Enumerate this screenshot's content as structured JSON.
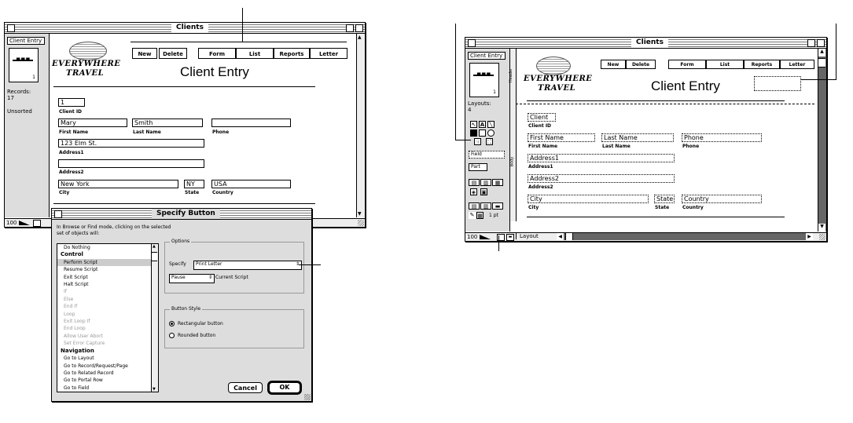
{
  "left_window": {
    "title": "Clients",
    "sidebar": {
      "layout_menu": "Client Entry",
      "book_page": "1",
      "records_label": "Records:",
      "records_count": "17",
      "unsorted": "Unsorted",
      "zoom": "100"
    },
    "logo": {
      "line1": "EVERYWHERE",
      "line2": "TRAVEL"
    },
    "buttons": [
      "New",
      "Delete",
      "Form",
      "List",
      "Reports",
      "Letter"
    ],
    "page_title": "Client Entry",
    "fields": {
      "client_id": {
        "value": "1",
        "label": "Client ID"
      },
      "first_name": {
        "value": "Mary",
        "label": "First Name"
      },
      "last_name": {
        "value": "Smith",
        "label": "Last Name"
      },
      "phone": {
        "value": "",
        "label": "Phone"
      },
      "address1": {
        "value": "123 Elm St.",
        "label": "Address1"
      },
      "address2": {
        "value": "",
        "label": "Address2"
      },
      "city": {
        "value": "New York",
        "label": "City"
      },
      "state": {
        "value": "NY",
        "label": "State"
      },
      "country": {
        "value": "USA",
        "label": "Country"
      }
    }
  },
  "dialog": {
    "title": "Specify Button",
    "instructions": "In Browse or Find mode, clicking on the selected set of objects will:",
    "script_list": [
      {
        "text": "Do Nothing",
        "kind": "item"
      },
      {
        "text": "Control",
        "kind": "header"
      },
      {
        "text": "Perform Script",
        "kind": "selected"
      },
      {
        "text": "Resume Script",
        "kind": "item"
      },
      {
        "text": "Exit Script",
        "kind": "item"
      },
      {
        "text": "Halt Script",
        "kind": "item"
      },
      {
        "text": "If",
        "kind": "disabled"
      },
      {
        "text": "Else",
        "kind": "disabled"
      },
      {
        "text": "End If",
        "kind": "disabled"
      },
      {
        "text": "Loop",
        "kind": "disabled"
      },
      {
        "text": "Exit Loop If",
        "kind": "disabled"
      },
      {
        "text": "End Loop",
        "kind": "disabled"
      },
      {
        "text": "Allow User Abort",
        "kind": "disabled"
      },
      {
        "text": "Set Error Capture",
        "kind": "disabled"
      },
      {
        "text": "Navigation",
        "kind": "header"
      },
      {
        "text": "Go to Layout",
        "kind": "item"
      },
      {
        "text": "Go to Record/Request/Page",
        "kind": "item"
      },
      {
        "text": "Go to Related Record",
        "kind": "item"
      },
      {
        "text": "Go to Portal Row",
        "kind": "item"
      },
      {
        "text": "Go to Field",
        "kind": "item"
      }
    ],
    "options_label": "Options",
    "specify_label": "Specify",
    "specify_value": "Print Letter",
    "pause_value": "Pause",
    "current_script_label": "Current Script",
    "button_style_label": "Button Style",
    "style_rect": "Rectangular button",
    "style_round": "Rounded button",
    "cancel_label": "Cancel",
    "ok_label": "OK"
  },
  "right_window": {
    "title": "Clients",
    "sidebar": {
      "layout_menu": "Client Entry",
      "book_page": "1",
      "layouts_label": "Layouts:",
      "layouts_count": "4",
      "field_tool": "Field",
      "part_tool": "Part",
      "line_size": "1 pt",
      "zoom": "100"
    },
    "parts": {
      "header": "Header",
      "body": "Body"
    },
    "logo": {
      "line1": "EVERYWHERE",
      "line2": "TRAVEL"
    },
    "buttons": [
      "New",
      "Delete",
      "Form",
      "List",
      "Reports",
      "Letter"
    ],
    "page_title": "Client Entry",
    "fields": {
      "client": {
        "value": "Client",
        "label": "Client ID"
      },
      "first": {
        "value": "First Name",
        "label": "First Name"
      },
      "last": {
        "value": "Last Name",
        "label": "Last Name"
      },
      "phone": {
        "value": "Phone",
        "label": "Phone"
      },
      "address1": {
        "value": "Address1",
        "label": "Address1"
      },
      "address2": {
        "value": "Address2",
        "label": "Address2"
      },
      "city": {
        "value": "City",
        "label": "City"
      },
      "state": {
        "value": "State",
        "label": "State"
      },
      "country": {
        "value": "Country",
        "label": "Country"
      }
    },
    "mode": "Layout"
  }
}
